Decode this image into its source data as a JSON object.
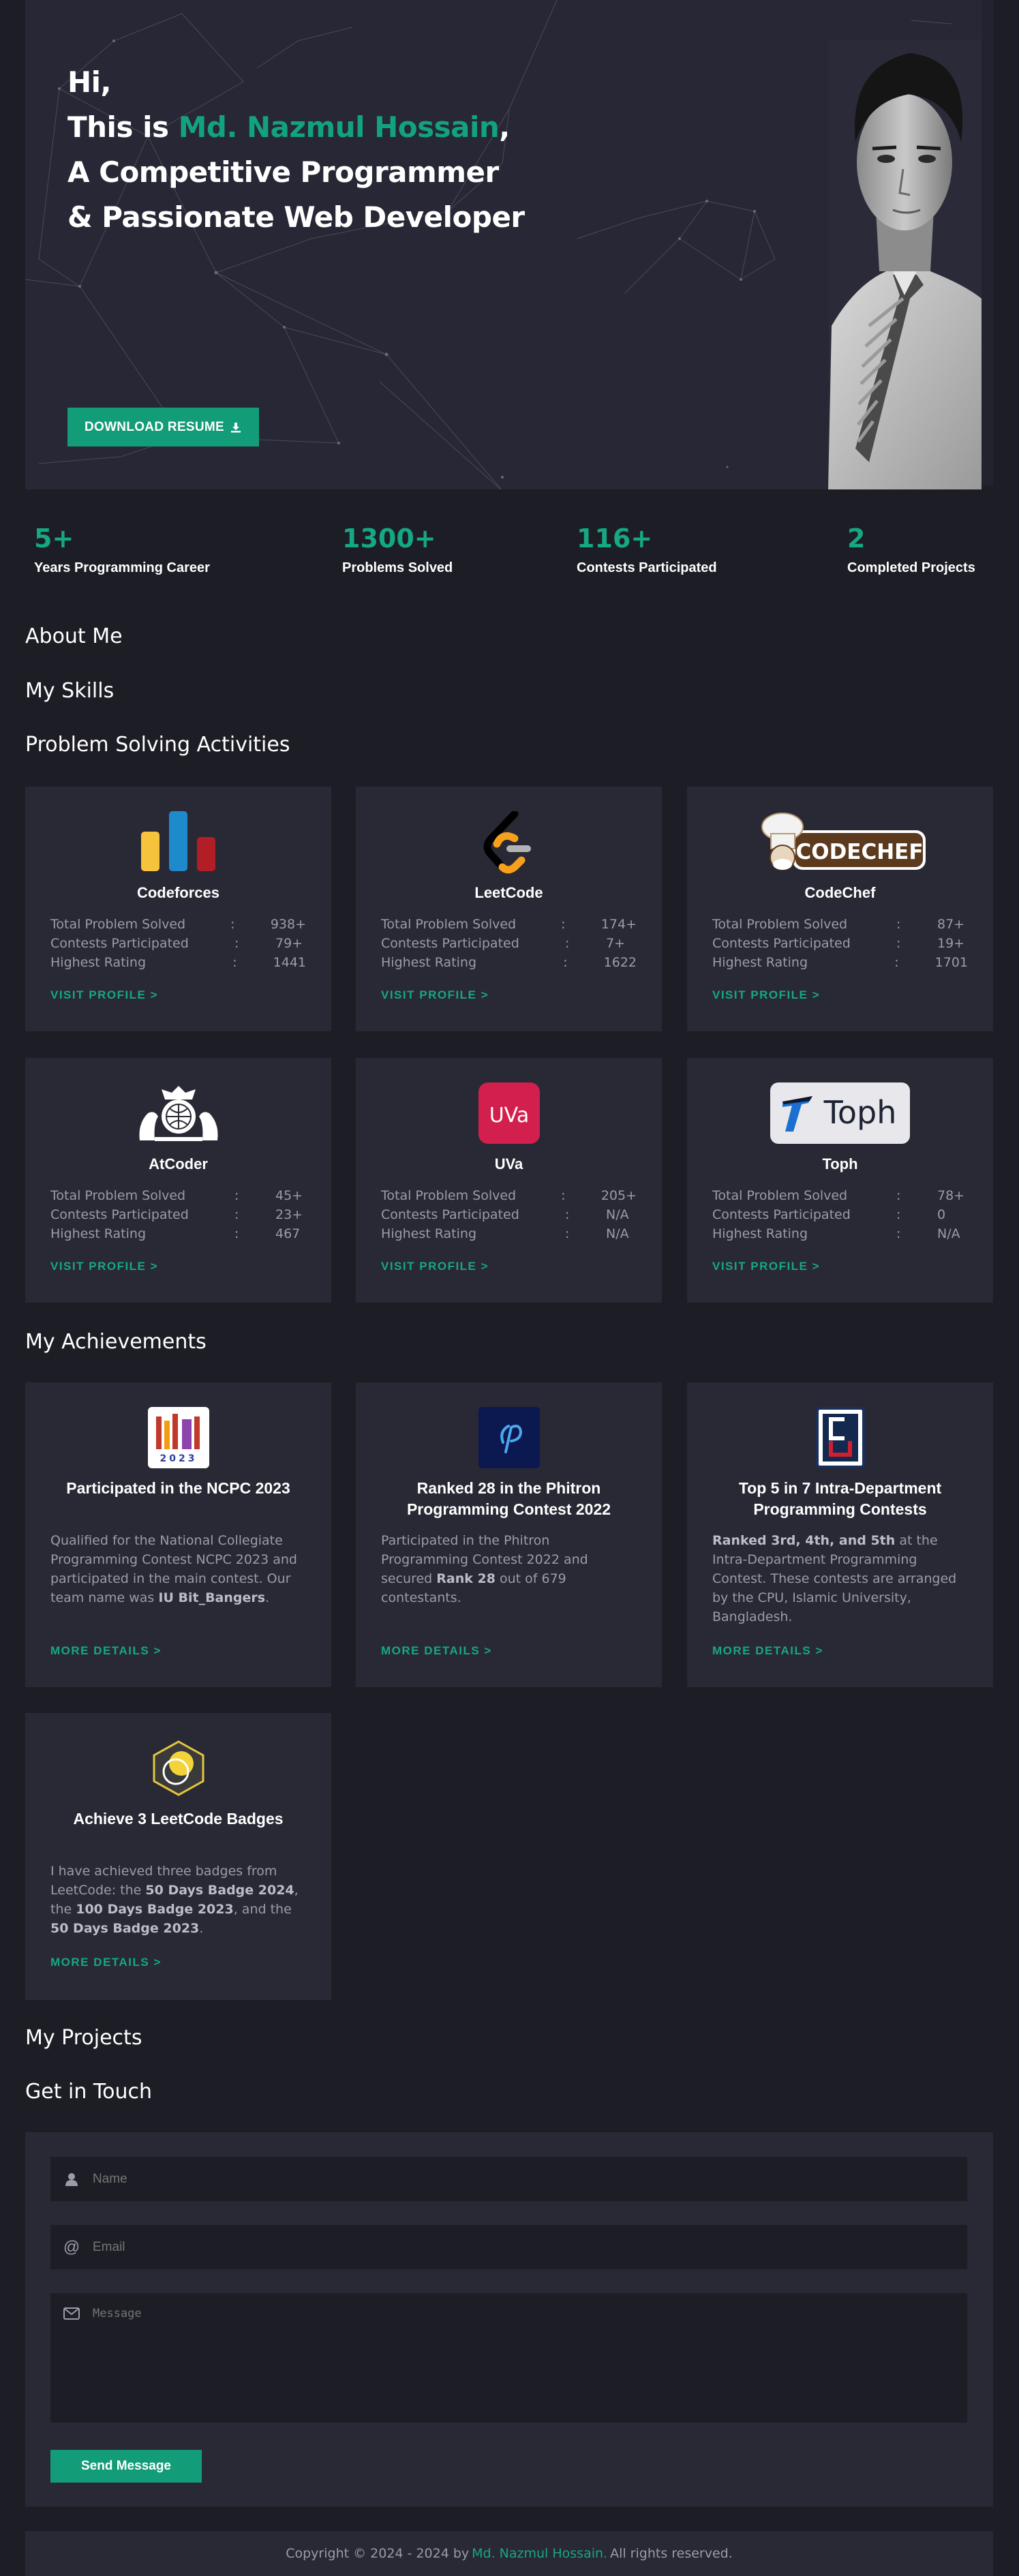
{
  "hero": {
    "line1": "Hi,",
    "line2_prefix": "This is ",
    "name": "Md. Nazmul Hossain",
    "line2_suffix": ",",
    "line3": "A Competitive Programmer",
    "line4": "& Passionate Web Developer",
    "download_label": "DOWNLOAD RESUME"
  },
  "stats": [
    {
      "num": "5+",
      "label": "Years Programming Career"
    },
    {
      "num": "1300+",
      "label": "Problems Solved"
    },
    {
      "num": "116+",
      "label": "Contests Participated"
    },
    {
      "num": "2",
      "label": "Completed Projects"
    }
  ],
  "sections": {
    "about": "About Me",
    "skills": "My Skills",
    "problem_solving": "Problem Solving Activities",
    "achievements": "My Achievements",
    "projects": "My Projects",
    "contact": "Get in Touch"
  },
  "stat_labels": {
    "solved": "Total Problem Solved",
    "contests": "Contests Participated",
    "rating": "Highest Rating",
    "sep": ":"
  },
  "platforms": [
    {
      "name": "Codeforces",
      "solved": "938+",
      "contests": "79+",
      "rating": "1441",
      "visit": "VISIT PROFILE >"
    },
    {
      "name": "LeetCode",
      "solved": "174+",
      "contests": "7+",
      "rating": "1622",
      "visit": "VISIT PROFILE >"
    },
    {
      "name": "CodeChef",
      "solved": "87+",
      "contests": "19+",
      "rating": "1701",
      "visit": "VISIT PROFILE >",
      "logo_text": "CODECHEF"
    },
    {
      "name": "AtCoder",
      "solved": "45+",
      "contests": "23+",
      "rating": "467",
      "visit": "VISIT PROFILE >"
    },
    {
      "name": "UVa",
      "solved": "205+",
      "contests": "N/A",
      "rating": "N/A",
      "visit": "VISIT PROFILE >",
      "logo_text": "UVa"
    },
    {
      "name": "Toph",
      "solved": "78+",
      "contests": "0",
      "rating": "N/A",
      "visit": "VISIT PROFILE >",
      "logo_text": "Toph"
    }
  ],
  "achievements": [
    {
      "title": "Participated in the NCPC 2023",
      "desc_parts": [
        "Qualified for the National Collegiate Programming Contest NCPC 2023 and participated in the main contest. Our team name was ",
        "IU Bit_Bangers",
        "."
      ],
      "more": "MORE DETAILS >",
      "logo_text": "2023"
    },
    {
      "title": "Ranked 28 in the Phitron Programming Contest 2022",
      "desc_parts": [
        "Participated in the Phitron Programming Contest 2022 and secured ",
        "Rank 28",
        " out of 679 contestants."
      ],
      "more": "MORE DETAILS >"
    },
    {
      "title": "Top 5 in 7 Intra-Department Programming Contests",
      "desc_parts": [
        "",
        "Ranked 3rd, 4th, and 5th",
        " at the Intra-Department Programming Contest. These contests are arranged by the CPU, Islamic University, Bangladesh."
      ],
      "more": "MORE DETAILS >"
    },
    {
      "title": "Achieve 3 LeetCode Badges",
      "desc_parts": [
        "I have achieved three badges from LeetCode: the ",
        "50 Days Badge 2024",
        ", the ",
        "100 Days Badge 2023",
        ", and the ",
        "50 Days Badge 2023",
        "."
      ],
      "more": "MORE DETAILS >"
    }
  ],
  "contact": {
    "name_placeholder": "Name",
    "email_placeholder": "Email",
    "message_placeholder": "Message",
    "send_label": "Send Message"
  },
  "footer": {
    "prefix": "Copyright © 2024 - 2024 by",
    "name": "Md. Nazmul Hossain.",
    "suffix": "All rights reserved."
  },
  "colors": {
    "accent": "#139c78",
    "bg": "#1d1d26",
    "card": "#292935"
  }
}
